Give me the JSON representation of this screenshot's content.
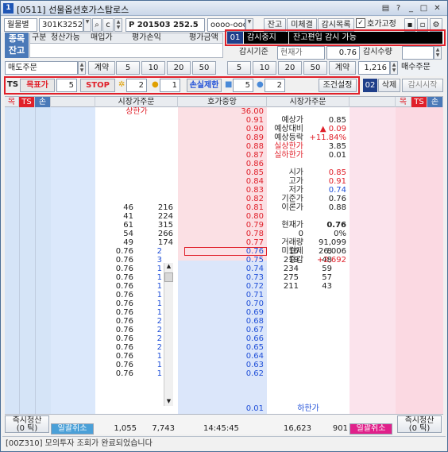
{
  "window": {
    "number": "1",
    "title": "[0511] 선물옵션호가스탑로스",
    "help_icon": "?",
    "btn_help": "?"
  },
  "toolbar1": {
    "combo1": "월물별",
    "combo2": "301K3252",
    "code": "P 201503 252.5",
    "pw": "oooo-oooo",
    "btn_balance": "잔고",
    "btn_unfilled": "미체결",
    "btn_watch": "감시목록",
    "chk_fix": "호가고정"
  },
  "tabs": {
    "left": "종목",
    "left2": "잔고",
    "cols": [
      "구분",
      "청산가능",
      "매입가",
      "평가손익",
      "평가금액"
    ]
  },
  "watch_panel": {
    "badge": "01",
    "status": "감시중지",
    "mode": "잔고편입 감시 가능",
    "base_label": "감시기준",
    "base_value": "현재가",
    "base_price": "0.76",
    "qty_label": "감시수량"
  },
  "order_row": {
    "sell_label": "매도주문",
    "sell_contract": "계약",
    "sell_q": [
      "5",
      "10",
      "20",
      "50"
    ],
    "buy_q": [
      "5",
      "10",
      "20",
      "50"
    ],
    "buy_contract": "계약",
    "buy_value": "1,216",
    "buy_label": "매수주문"
  },
  "ts_row": {
    "ts": "TS",
    "target_label": "목표가",
    "target_val": "5",
    "stop_label": "STOP",
    "v2": "2",
    "v1": "1",
    "loss_label": "손실제한",
    "loss_val": "5",
    "loss_v2": "2",
    "cond_btn": "조건설정",
    "badge": "02",
    "del_btn": "삭제",
    "start_btn": "감시시작"
  },
  "header": {
    "l1": "목",
    "l2": "TS",
    "l3": "손",
    "market_sell": "시장가주문",
    "center": "호가중앙",
    "market_buy": "시장가주문",
    "r1": "목",
    "r2": "TS",
    "r3": "손"
  },
  "upper_limit_label": "상한가",
  "upper_limit_value": "36.00",
  "lower_limit_label": "하한가",
  "lower_limit_value": "0.01",
  "prices": [
    "0.91",
    "0.90",
    "0.89",
    "0.88",
    "0.87",
    "0.86",
    "0.85",
    "0.84",
    "0.83",
    "0.82",
    "0.81",
    "0.80",
    "0.79",
    "0.78",
    "0.77",
    "0.76",
    "0.75",
    "0.74",
    "0.73",
    "0.72",
    "0.71",
    "0.70",
    "0.69",
    "0.68",
    "0.67",
    "0.66",
    "0.65",
    "0.64",
    "0.63",
    "0.62"
  ],
  "sell_qty": [
    [
      "46",
      "216"
    ],
    [
      "41",
      "224"
    ],
    [
      "61",
      "315"
    ],
    [
      "54",
      "266"
    ],
    [
      "49",
      "174"
    ]
  ],
  "buy_qty": [
    [
      "16",
      "8"
    ],
    [
      "219",
      "48"
    ],
    [
      "234",
      "59"
    ],
    [
      "275",
      "57"
    ],
    [
      "211",
      "43"
    ]
  ],
  "info": [
    [
      "예상가",
      "0.85"
    ],
    [
      "예상대비",
      "▲ 0.09"
    ],
    [
      "예상등락",
      "+11.84%"
    ],
    [
      "실상한가",
      "3.85"
    ],
    [
      "실하한가",
      "0.01"
    ],
    [
      "",
      ""
    ],
    [
      "시가",
      "0.85"
    ],
    [
      "고가",
      "0.91"
    ],
    [
      "저가",
      "0.74"
    ],
    [
      "기준가",
      "0.76"
    ],
    [
      "이론가",
      "0.88"
    ],
    [
      "",
      ""
    ],
    [
      "현재가",
      "0.76"
    ],
    [
      "0",
      "0%"
    ],
    [
      "거래량",
      "91,099"
    ],
    [
      "미결제",
      "26,006"
    ],
    [
      "증감",
      "+2,692"
    ]
  ],
  "left_list": [
    [
      "0.76",
      "2"
    ],
    [
      "0.76",
      "3"
    ],
    [
      "0.76",
      "1"
    ],
    [
      "0.76",
      "1"
    ],
    [
      "0.76",
      "1"
    ],
    [
      "0.76",
      "1"
    ],
    [
      "0.76",
      "1"
    ],
    [
      "0.76",
      "1"
    ],
    [
      "0.76",
      "2"
    ],
    [
      "0.76",
      "2"
    ],
    [
      "0.76",
      "2"
    ],
    [
      "0.76",
      "2"
    ],
    [
      "0.76",
      "1"
    ],
    [
      "0.76",
      "1"
    ],
    [
      "0.76",
      "1"
    ],
    [
      "0.76",
      "2"
    ]
  ],
  "footer": {
    "clear_left": "즉시청산",
    "clear_left_sub": "(0 틱)",
    "cancel_left": "일괄취소",
    "sell_total": "1,055",
    "sell_total2": "7,743",
    "time": "14:45:45",
    "buy_total": "16,623",
    "buy_total2": "901",
    "cancel_right": "일괄취소",
    "clear_right": "즉시청산",
    "clear_right_sub": "(0 틱)"
  },
  "status_text": "[00Z310]  모의투자 조회가 완료되었습니다",
  "colors": {
    "red": "#e0202a",
    "blue": "#1f4fd8",
    "black_panel": "#000000",
    "ask_bg": "#dbe8fb",
    "bid_bg": "#fbe3ec",
    "center_ask": "#fbe0e4",
    "center_bid": "#dbe6fa"
  }
}
